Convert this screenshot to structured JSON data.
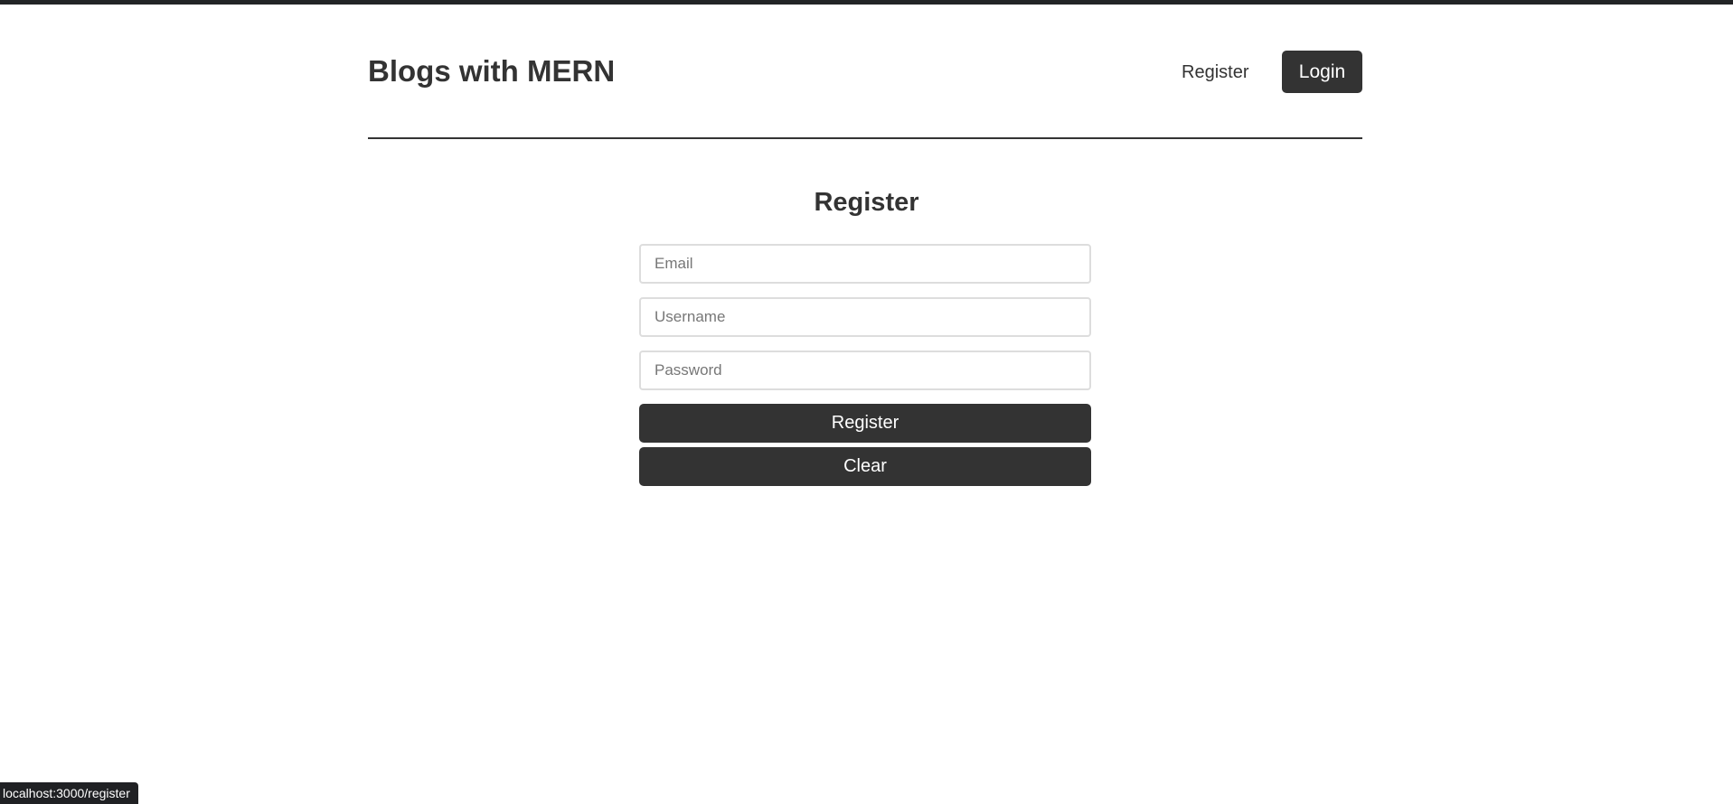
{
  "header": {
    "brand": "Blogs with MERN",
    "nav": {
      "register_label": "Register",
      "login_label": "Login"
    }
  },
  "form": {
    "title": "Register",
    "email_placeholder": "Email",
    "username_placeholder": "Username",
    "password_placeholder": "Password",
    "email_value": "",
    "username_value": "",
    "password_value": "",
    "register_label": "Register",
    "clear_label": "Clear"
  },
  "status_bar": {
    "url": "localhost:3000/register"
  },
  "colors": {
    "primary": "#333333",
    "top_bar": "#222426",
    "input_border": "#dddddd",
    "background": "#ffffff"
  }
}
